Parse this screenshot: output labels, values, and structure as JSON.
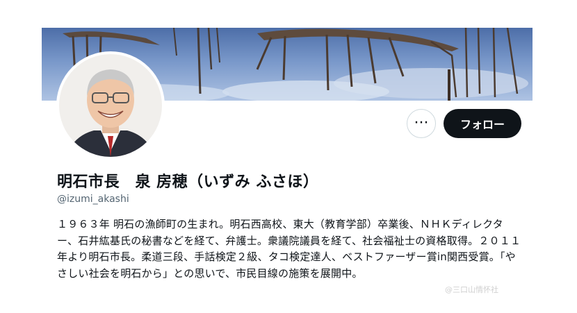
{
  "profile": {
    "display_name": "明石市長　泉 房穂（いずみ ふさほ）",
    "username": "@izumi_akashi",
    "bio": "１９６３年 明石の漁師町の生まれ。明石西高校、東大（教育学部）卒業後、ＮＨＫディレクター、石井紘基氏の秘書などを経て、弁護士。衆議院議員を経て、社会福祉士の資格取得。２０１１年より明石市長。柔道三段、手話検定２級、タコ検定達人、ベストファーザー賞in関西受賞。「やさしい社会を明石から」との思いで、市民目線の施策を展開中。"
  },
  "actions": {
    "more_label": "···",
    "follow_label": "フォロー"
  },
  "banner_icon": "surreal-elephant-legs-art",
  "avatar_icon": "smiling-man-with-glasses-portrait",
  "watermark_text": "@三口山情怀社",
  "colors": {
    "primary_text": "#0f1419",
    "secondary_text": "#536471",
    "follow_button_bg": "#0f1419",
    "border": "#cfd9de"
  }
}
